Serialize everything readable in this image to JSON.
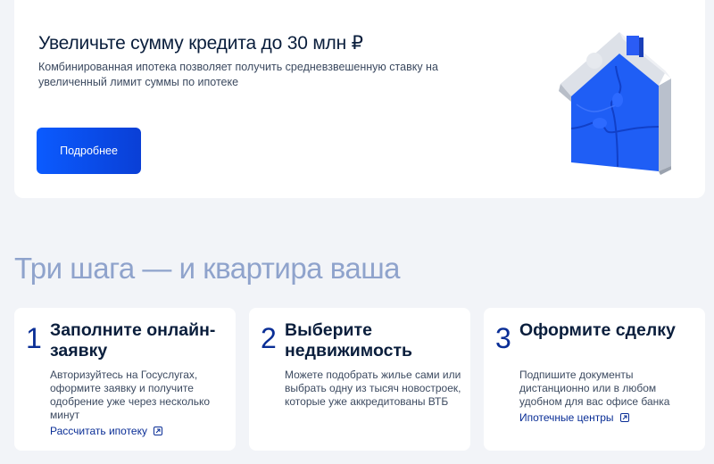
{
  "promo": {
    "title": "Увеличьте сумму кредита до 30 млн ₽",
    "description": "Комбинированная ипотека позволяет получить средневзвешенную ставку на увеличенный лимит суммы по ипотеке",
    "button_label": "Подробнее"
  },
  "steps": {
    "title": "Три шага — и квартира ваша",
    "items": [
      {
        "number": "1",
        "title": "Заполните онлайн-заявку",
        "text": "Авторизуйтесь на Госуслугах, оформите заявку и получите одобрение уже через несколько минут",
        "link": "Рассчитать ипотеку"
      },
      {
        "number": "2",
        "title": "Выберите недвижимость",
        "text": "Можете подобрать жилье сами или выбрать одну из тысяч новостроек, которые уже аккредитованы ВТБ"
      },
      {
        "number": "3",
        "title": "Оформите сделку",
        "text": "Подпишите документы дистанционно или в любом удобном для вас офисе банка",
        "link": "Ипотечные центры"
      }
    ]
  },
  "colors": {
    "accent": "#0a2e96",
    "button": "#0b5bff",
    "heading_muted": "#8fa3cc",
    "background": "#f2f4f8"
  },
  "icons": {
    "promo_illustration": "puzzle-house-icon",
    "link_icon": "external-link-icon"
  }
}
